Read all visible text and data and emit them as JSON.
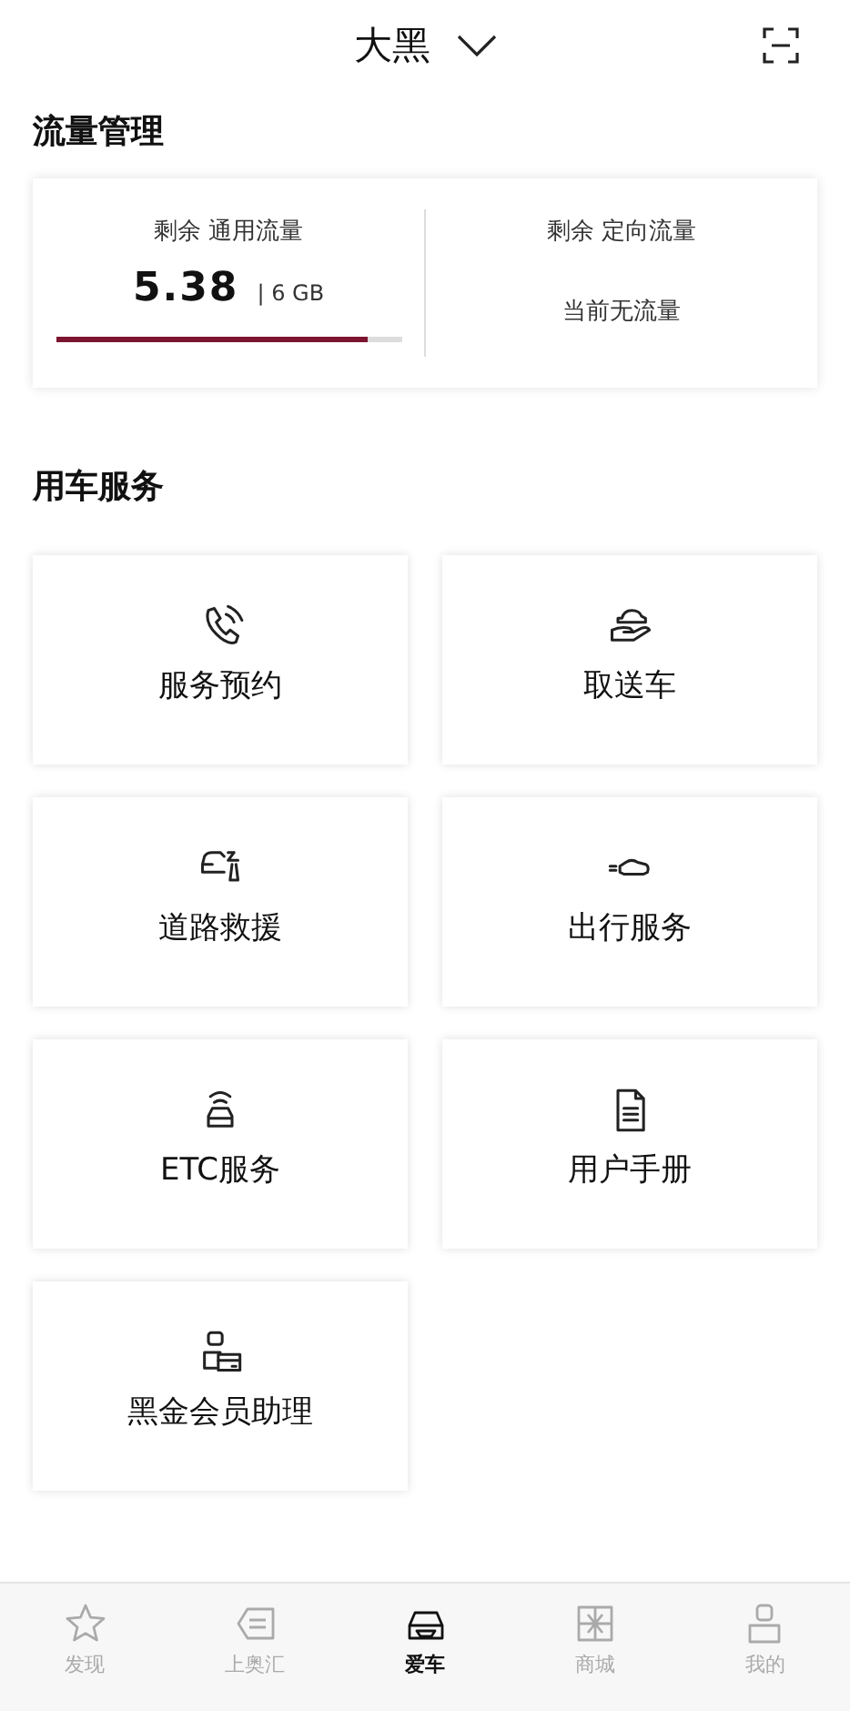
{
  "header": {
    "title": "大黑"
  },
  "traffic": {
    "title": "流量管理",
    "general": {
      "label": "剩余 通用流量",
      "value": "5.38",
      "total": "| 6 GB",
      "level": 0.9
    },
    "directed": {
      "label": "剩余 定向流量",
      "status": "当前无流量"
    }
  },
  "services": {
    "title": "用车服务",
    "items": [
      {
        "label": "服务预约"
      },
      {
        "label": "取送车"
      },
      {
        "label": "道路救援"
      },
      {
        "label": "出行服务"
      },
      {
        "label": "ETC服务"
      },
      {
        "label": "用户手册"
      },
      {
        "label": "黑金会员助理"
      }
    ]
  },
  "tab_bar": [
    {
      "label": "发现",
      "selected": false
    },
    {
      "label": "上奥汇",
      "selected": false
    },
    {
      "label": "爱车",
      "selected": true
    },
    {
      "label": "商城",
      "selected": false
    },
    {
      "label": "我的",
      "selected": false
    }
  ]
}
